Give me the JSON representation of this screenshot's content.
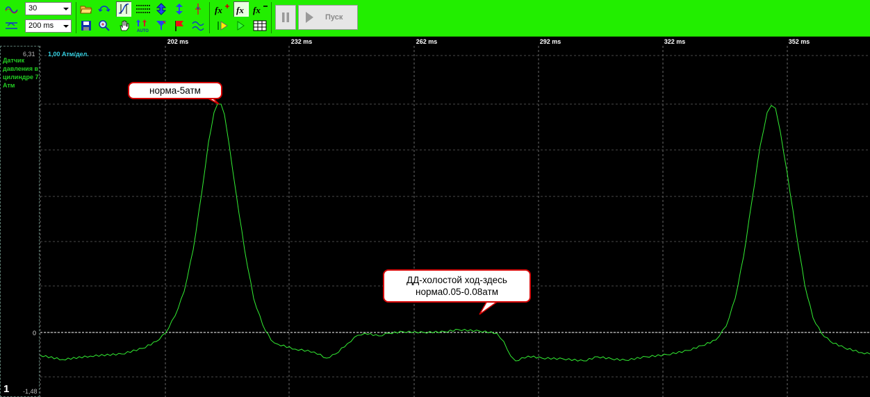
{
  "toolbar": {
    "sweep_value": "30",
    "timebase_value": "200 ms",
    "start_label": "Пуск"
  },
  "axis": {
    "time_labels": [
      "202 ms",
      "232 ms",
      "262 ms",
      "292 ms",
      "322 ms",
      "352 ms"
    ],
    "y_max": "6,31",
    "y_min": "-1,48",
    "y_zero": "0",
    "scale": "1,00 Атм/дел."
  },
  "channel": {
    "name": "Датчик давления в цилиндре 7 Атм",
    "number": "1"
  },
  "annotations": {
    "peak": "норма-5атм",
    "idle_line1": "ДД-холостой ход-здесь",
    "idle_line2": "норма0.05-0.08атм"
  },
  "colors": {
    "toolbar_bg": "#22ee00",
    "trace": "#33ee33",
    "grid": "#6a6a6a",
    "zero_line": "#ffffff",
    "callout_border": "#d40000"
  },
  "icons": [
    "sine-wave-icon",
    "trigger-wave-icon",
    "open-folder-icon",
    "save-icon",
    "loop-icon",
    "zoom-icon",
    "cursor-icon",
    "hand-icon",
    "lines-icon",
    "auto-scale-icon",
    "move-updown-icon",
    "marker-icon",
    "pause-icon",
    "play-icon",
    "fx-add-icon",
    "fx-icon",
    "fx-remove-icon",
    "grid-table-icon"
  ]
}
